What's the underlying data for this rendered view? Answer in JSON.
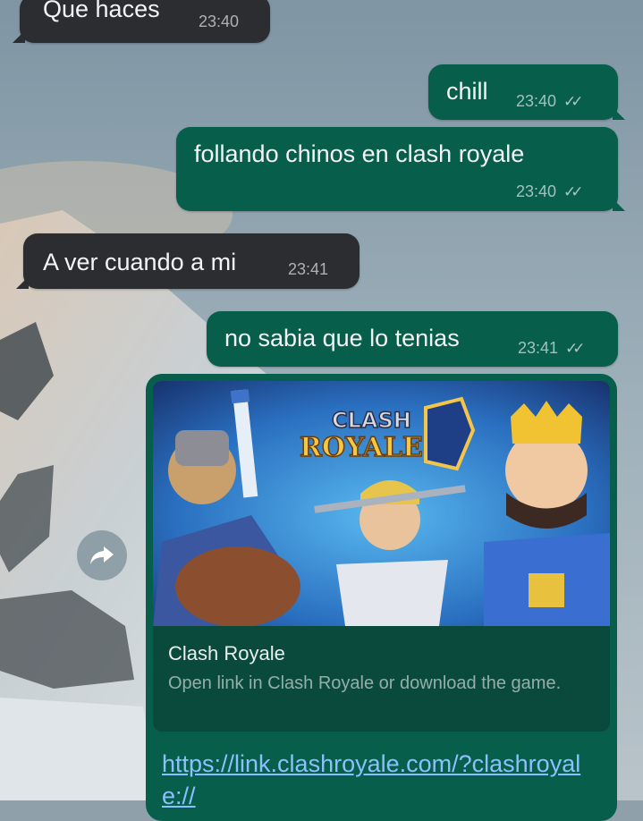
{
  "messages": [
    {
      "id": "m1",
      "direction": "incoming",
      "text": "Que haces",
      "time": "23:40"
    },
    {
      "id": "m2",
      "direction": "outgoing",
      "text": "chill",
      "time": "23:40"
    },
    {
      "id": "m3",
      "direction": "outgoing",
      "text": "follando chinos en clash royale",
      "time": "23:40"
    },
    {
      "id": "m4",
      "direction": "incoming",
      "text": "A ver cuando a mi",
      "time": "23:41"
    },
    {
      "id": "m5",
      "direction": "outgoing",
      "text": "no sabia que lo tenias",
      "time": "23:41"
    }
  ],
  "link_preview": {
    "logo_line1": "CLASH",
    "logo_line2": "ROYALE",
    "title": "Clash Royale",
    "description": "Open link in Clash Royale or download the game.",
    "url": "https://link.clashroyale.com/?clashroyale://"
  },
  "icons": {
    "forward": "forward-arrow-icon",
    "read_receipt": "double-check-icon"
  },
  "colors": {
    "incoming_bubble": "#2b2d31",
    "outgoing_bubble": "#075e4b",
    "link": "#8bc0ff"
  }
}
